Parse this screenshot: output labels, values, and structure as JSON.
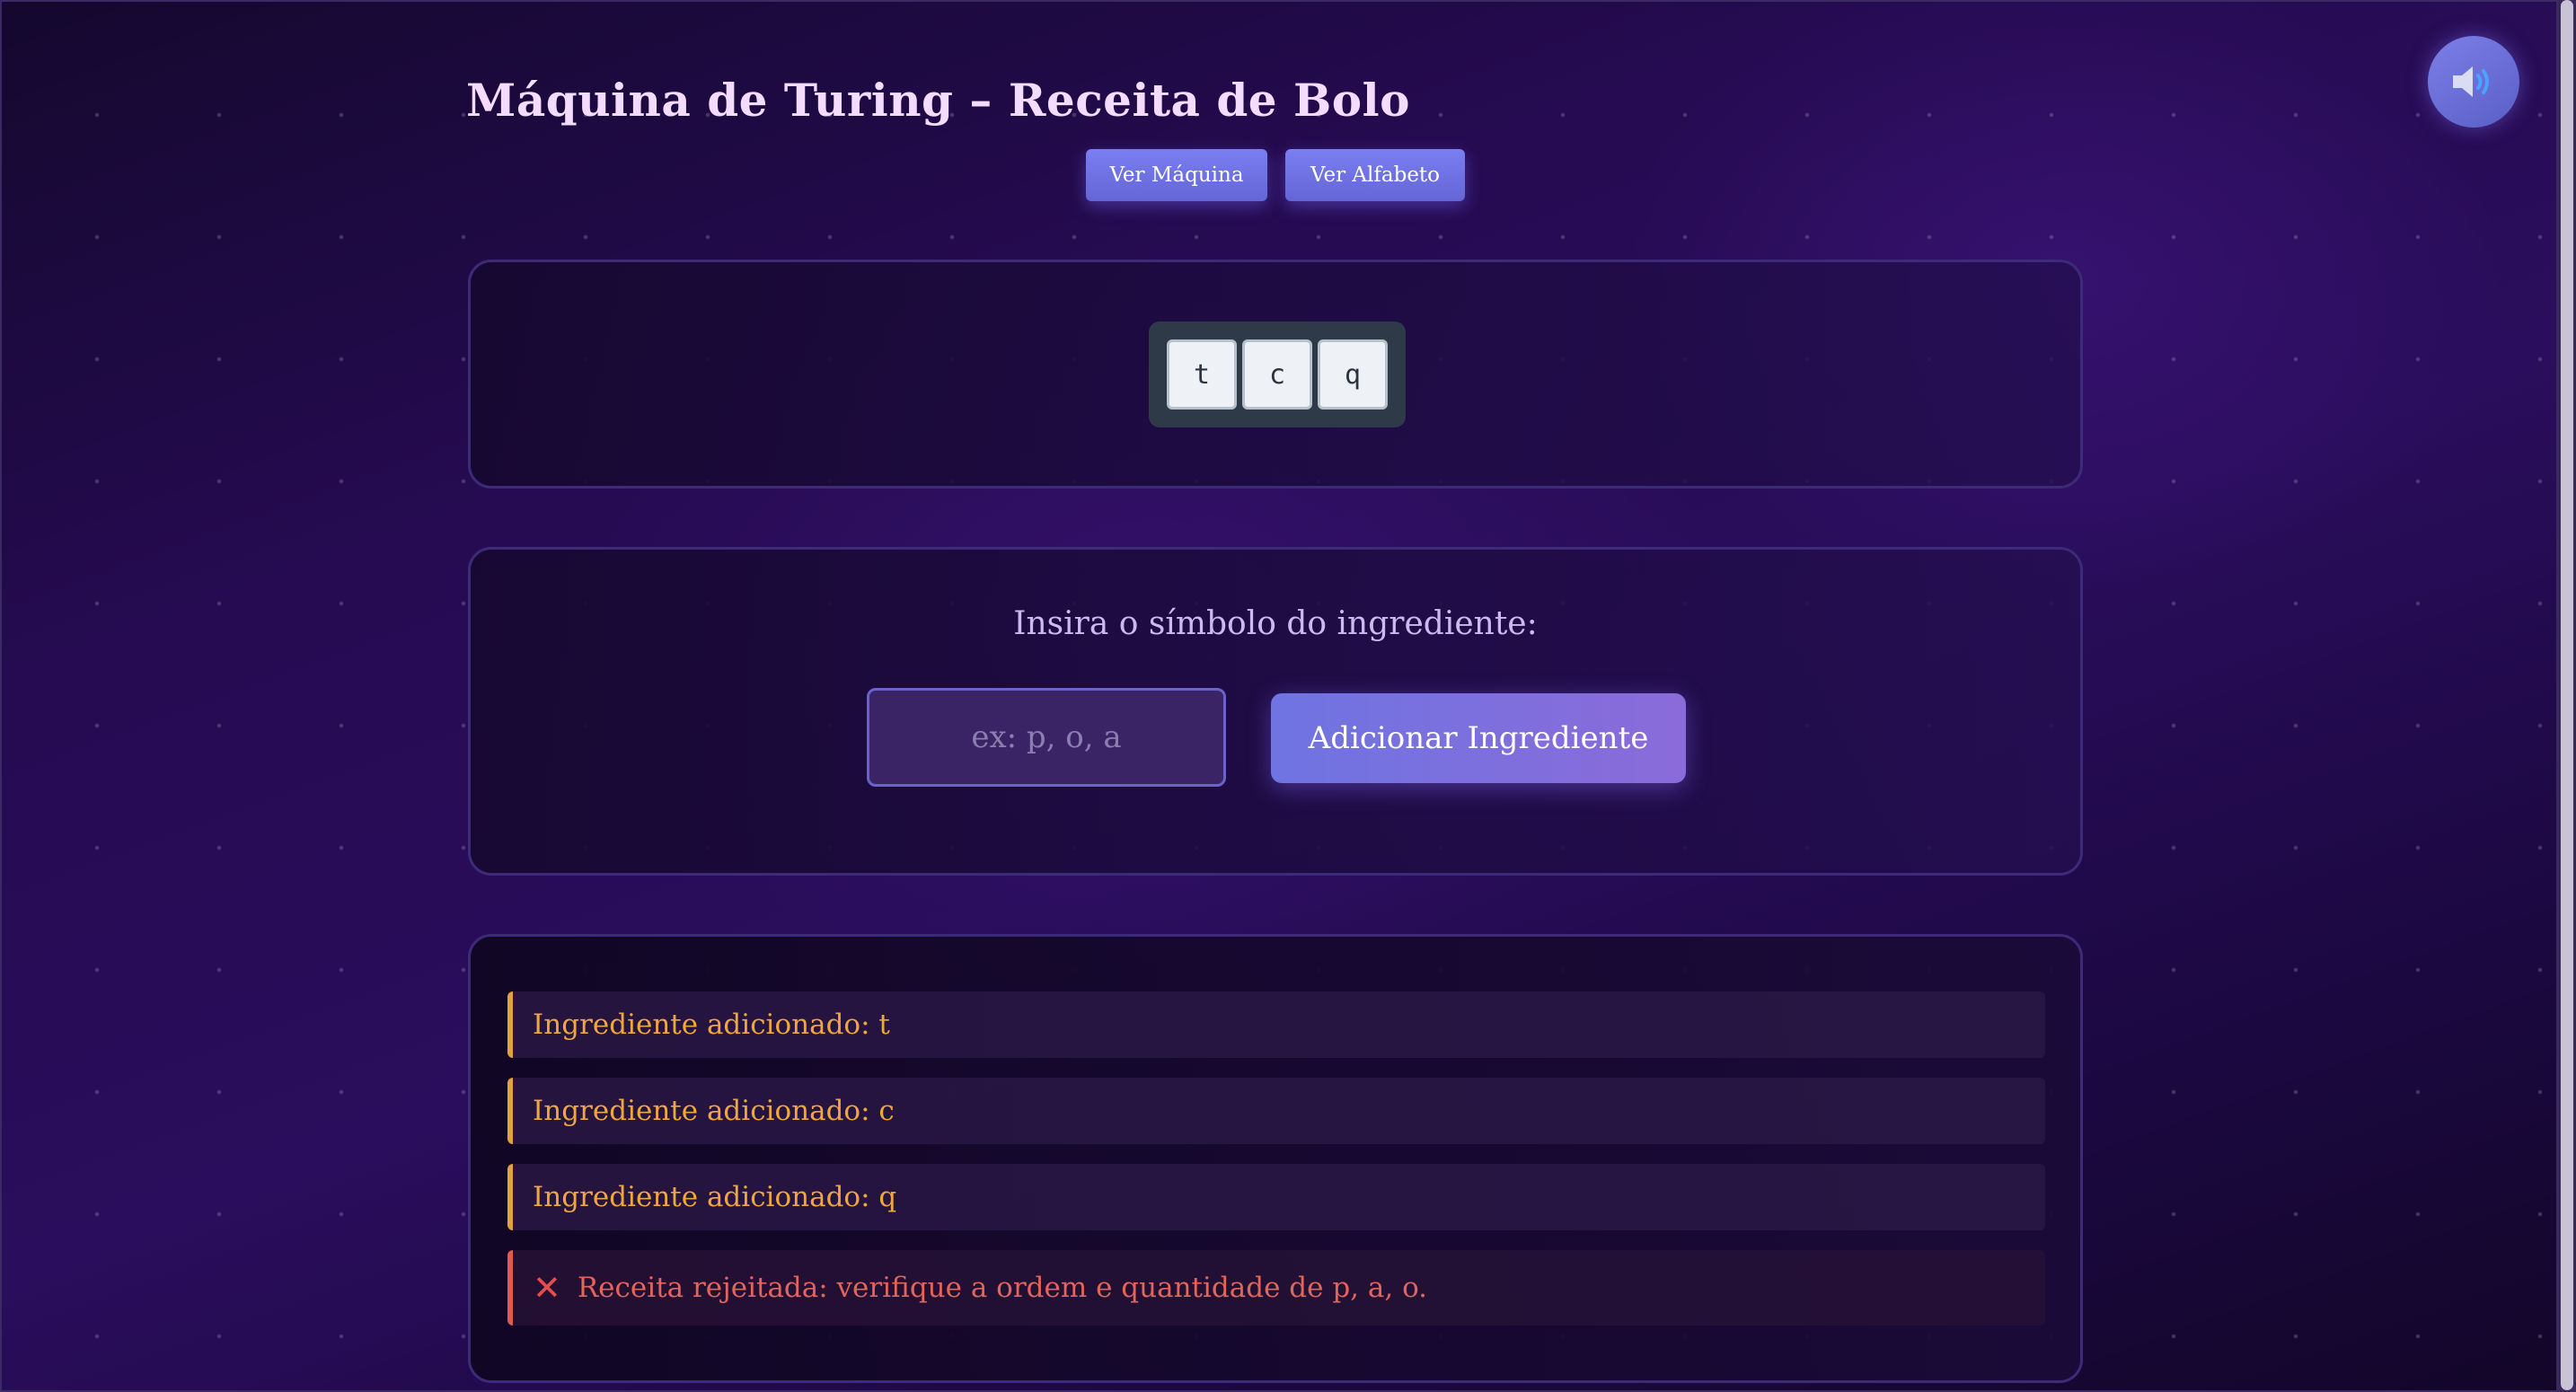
{
  "header": {
    "title": "Máquina de Turing – Receita de Bolo",
    "buttons": {
      "view_machine": "Ver Máquina",
      "view_alphabet": "Ver Alfabeto"
    },
    "sound_icon": "speaker-icon"
  },
  "tape": {
    "cells": [
      "t",
      "c",
      "q"
    ]
  },
  "input_section": {
    "prompt": "Insira o símbolo do ingrediente:",
    "placeholder": "ex: p, o, a",
    "value": "",
    "add_button": "Adicionar Ingrediente"
  },
  "log": {
    "entries": [
      "Ingrediente adicionado: t",
      "Ingrediente adicionado: c",
      "Ingrediente adicionado: q"
    ],
    "error": {
      "icon": "x-mark-icon",
      "text": "Receita rejeitada: verifique a ordem e quantidade de p, a, o."
    }
  },
  "colors": {
    "accent": "#6f74e2",
    "log_text": "#f0a63e",
    "error_text": "#e2645a",
    "background": "#2a0d5c"
  }
}
